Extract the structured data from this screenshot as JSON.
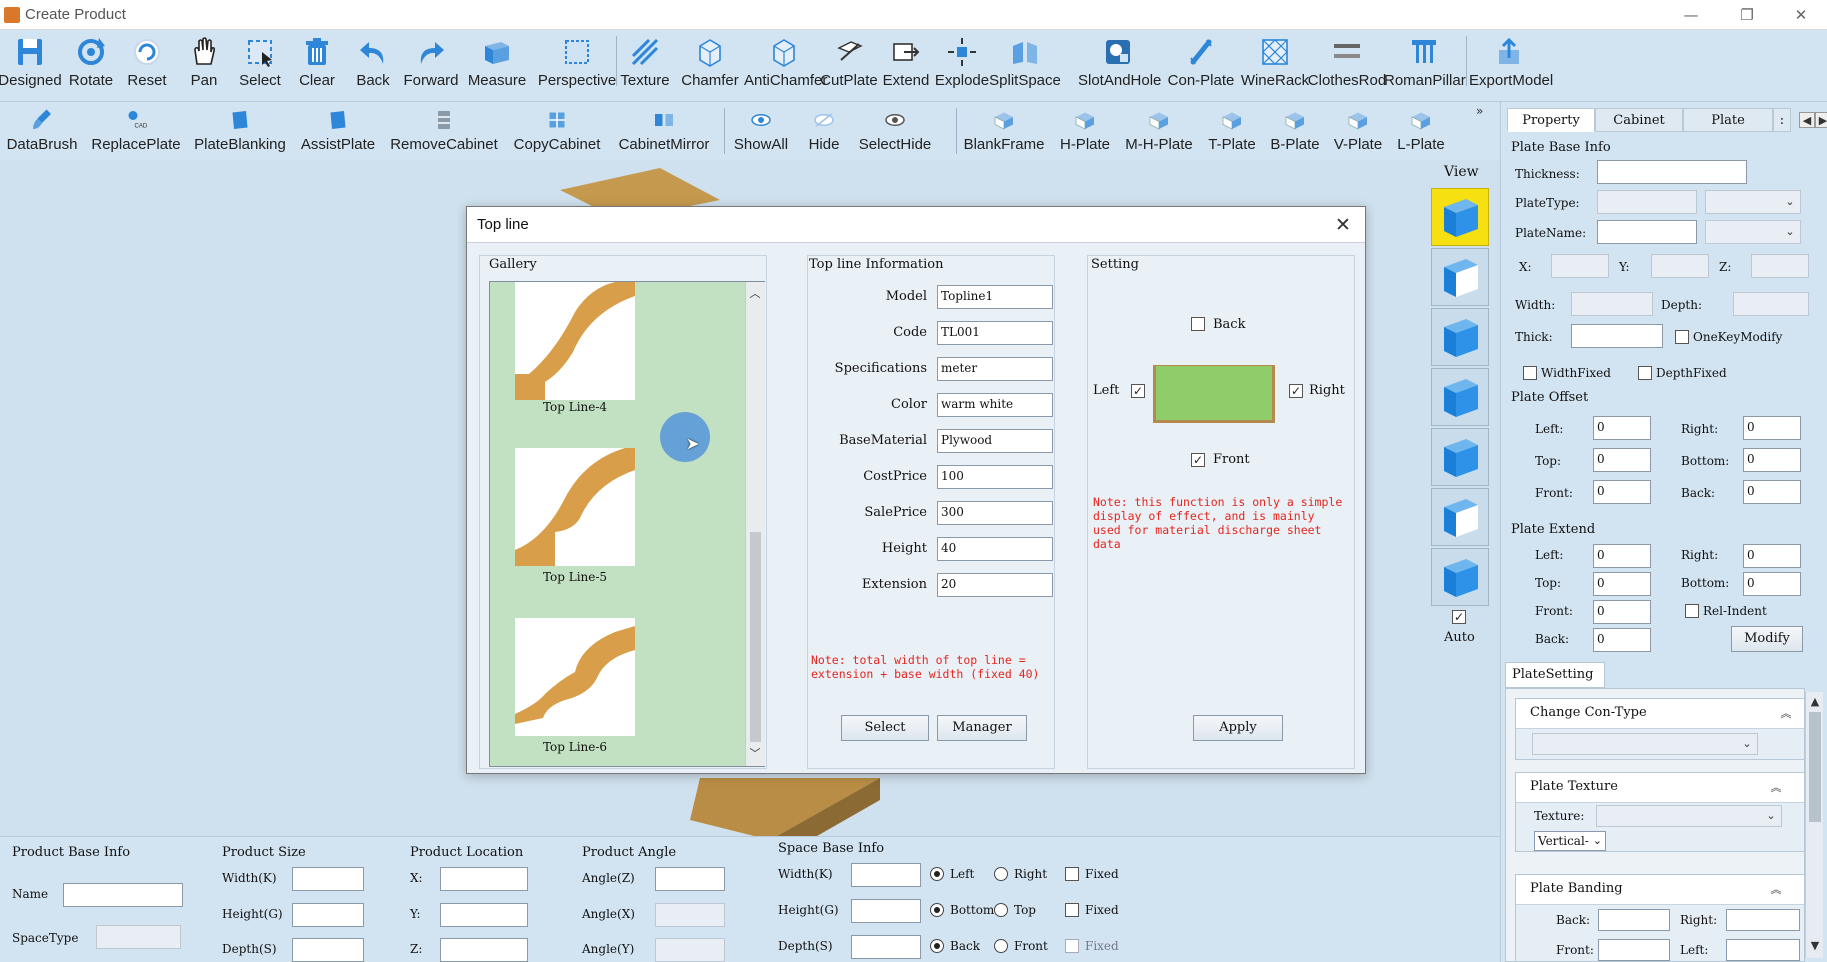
{
  "window": {
    "title": "Create Product"
  },
  "toolbar1": [
    {
      "label": "Designed",
      "icon": "save-icon"
    },
    {
      "label": "Rotate",
      "icon": "rotate-icon"
    },
    {
      "label": "Reset",
      "icon": "reset-icon"
    },
    {
      "label": "Pan",
      "icon": "hand-icon"
    },
    {
      "label": "Select",
      "icon": "select-icon"
    },
    {
      "label": "Clear",
      "icon": "trash-icon"
    },
    {
      "label": "Back",
      "icon": "undo-icon"
    },
    {
      "label": "Forward",
      "icon": "redo-icon"
    },
    {
      "label": "Measure",
      "icon": "measure-icon"
    },
    {
      "label": "Perspective",
      "icon": "perspective-icon"
    },
    {
      "label": "Texture",
      "icon": "texture-icon"
    },
    {
      "label": "Chamfer",
      "icon": "chamfer-icon"
    },
    {
      "label": "AntiChamfer",
      "icon": "antichamfer-icon"
    },
    {
      "label": "CutPlate",
      "icon": "cutplate-icon"
    },
    {
      "label": "Extend",
      "icon": "extend-icon"
    },
    {
      "label": "Explode",
      "icon": "explode-icon"
    },
    {
      "label": "SplitSpace",
      "icon": "splitspace-icon"
    },
    {
      "label": "SlotAndHole",
      "icon": "slot-icon"
    },
    {
      "label": "Con-Plate",
      "icon": "conplate-icon"
    },
    {
      "label": "WineRack",
      "icon": "winerack-icon"
    },
    {
      "label": "ClothesRod",
      "icon": "clothesrod-icon"
    },
    {
      "label": "RomanPillar",
      "icon": "pillar-icon"
    },
    {
      "label": "ExportModel",
      "icon": "export-icon"
    }
  ],
  "toolbar2": [
    {
      "label": "DataBrush",
      "icon": "brush-icon"
    },
    {
      "label": "ReplacePlate",
      "icon": "replace-plate-icon",
      "badge": "CAD"
    },
    {
      "label": "PlateBlanking",
      "icon": "plate-blanking-icon"
    },
    {
      "label": "AssistPlate",
      "icon": "assist-plate-icon"
    },
    {
      "label": "RemoveCabinet",
      "icon": "remove-cabinet-icon"
    },
    {
      "label": "CopyCabinet",
      "icon": "copy-cabinet-icon"
    },
    {
      "label": "CabinetMirror",
      "icon": "mirror-icon"
    },
    {
      "label": "ShowAll",
      "icon": "eye-icon"
    },
    {
      "label": "Hide",
      "icon": "hide-icon"
    },
    {
      "label": "SelectHide",
      "icon": "select-hide-icon"
    },
    {
      "label": "BlankFrame",
      "icon": "blank-frame-icon"
    },
    {
      "label": "H-Plate",
      "icon": "h-plate-icon"
    },
    {
      "label": "M-H-Plate",
      "icon": "m-h-plate-icon"
    },
    {
      "label": "T-Plate",
      "icon": "t-plate-icon"
    },
    {
      "label": "B-Plate",
      "icon": "b-plate-icon"
    },
    {
      "label": "V-Plate",
      "icon": "v-plate-icon"
    },
    {
      "label": "L-Plate",
      "icon": "l-plate-icon"
    }
  ],
  "view": {
    "label": "View",
    "auto_label": "Auto",
    "auto_checked": true
  },
  "dialog": {
    "title": "Top line",
    "gallery": {
      "label": "Gallery",
      "items": [
        "Top Line-4",
        "Top Line-5",
        "Top Line-6"
      ]
    },
    "info": {
      "label": "Top line Information",
      "fields": [
        {
          "label": "Model",
          "value": "Topline1"
        },
        {
          "label": "Code",
          "value": "TL001"
        },
        {
          "label": "Specifications",
          "value": "meter"
        },
        {
          "label": "Color",
          "value": "warm white"
        },
        {
          "label": "BaseMaterial",
          "value": "Plywood"
        },
        {
          "label": "CostPrice",
          "value": "100"
        },
        {
          "label": "SalePrice",
          "value": "300"
        },
        {
          "label": "Height",
          "value": "40"
        },
        {
          "label": "Extension",
          "value": "20"
        }
      ],
      "note": "Note: total width of top line = extension + base width (fixed 40)",
      "select_btn": "Select",
      "manager_btn": "Manager"
    },
    "setting": {
      "label": "Setting",
      "back": "Back",
      "left": "Left",
      "right": "Right",
      "front": "Front",
      "back_checked": false,
      "left_checked": true,
      "right_checked": true,
      "front_checked": true,
      "note": "Note: this function is only a simple display of effect, and is mainly used for material discharge sheet data",
      "apply_btn": "Apply"
    }
  },
  "right_panel": {
    "tabs": [
      "Property",
      "Cabinet",
      "Plate"
    ],
    "plate_base_info": {
      "title": "Plate Base Info",
      "thickness": "Thickness:",
      "plate_type": "PlateType:",
      "plate_name": "PlateName:",
      "x": "X:",
      "y": "Y:",
      "z": "Z:",
      "width": "Width:",
      "depth": "Depth:",
      "thick": "Thick:",
      "one_key_modify": "OneKeyModify",
      "width_fixed": "WidthFixed",
      "depth_fixed": "DepthFixed"
    },
    "plate_offset": {
      "title": "Plate Offset",
      "left": "Left:",
      "right": "Right:",
      "top": "Top:",
      "bottom": "Bottom:",
      "front": "Front:",
      "back": "Back:",
      "values": {
        "left": "0",
        "right": "0",
        "top": "0",
        "bottom": "0",
        "front": "0",
        "back": "0"
      }
    },
    "plate_extend": {
      "title": "Plate Extend",
      "left": "Left:",
      "right": "Right:",
      "top": "Top:",
      "bottom": "Bottom:",
      "front": "Front:",
      "back": "Back:",
      "rel_indent": "Rel-Indent",
      "modify": "Modify",
      "values": {
        "left": "0",
        "right": "0",
        "top": "0",
        "bottom": "0",
        "front": "0",
        "back": "0"
      }
    },
    "plate_setting": {
      "title": "PlateSetting",
      "change_con_type": "Change Con-Type",
      "plate_texture": "Plate Texture",
      "texture": "Texture:",
      "vertical": "Vertical-",
      "plate_banding": "Plate Banding",
      "back": "Back:",
      "right": "Right:",
      "front": "Front:",
      "left": "Left:"
    }
  },
  "bottom_panel": {
    "product_base_info": {
      "title": "Product Base Info",
      "name": "Name",
      "space_type": "SpaceType"
    },
    "product_size": {
      "title": "Product Size",
      "width": "Width(K)",
      "height": "Height(G)",
      "depth": "Depth(S)"
    },
    "product_location": {
      "title": "Product Location",
      "x": "X:",
      "y": "Y:",
      "z": "Z:"
    },
    "product_angle": {
      "title": "Product Angle",
      "az": "Angle(Z)",
      "ax": "Angle(X)",
      "ay": "Angle(Y)"
    },
    "space_base_info": {
      "title": "Space Base Info",
      "width": "Width(K)",
      "height": "Height(G)",
      "depth": "Depth(S)",
      "left": "Left",
      "right": "Right",
      "bottom": "Bottom",
      "top": "Top",
      "back": "Back",
      "front": "Front",
      "fixed": "Fixed"
    }
  },
  "colors": {
    "accent": "#1e88e5",
    "note": "#e5261f",
    "gallery_bg": "#c2e0c2",
    "preview_green": "#8fcd6a"
  }
}
